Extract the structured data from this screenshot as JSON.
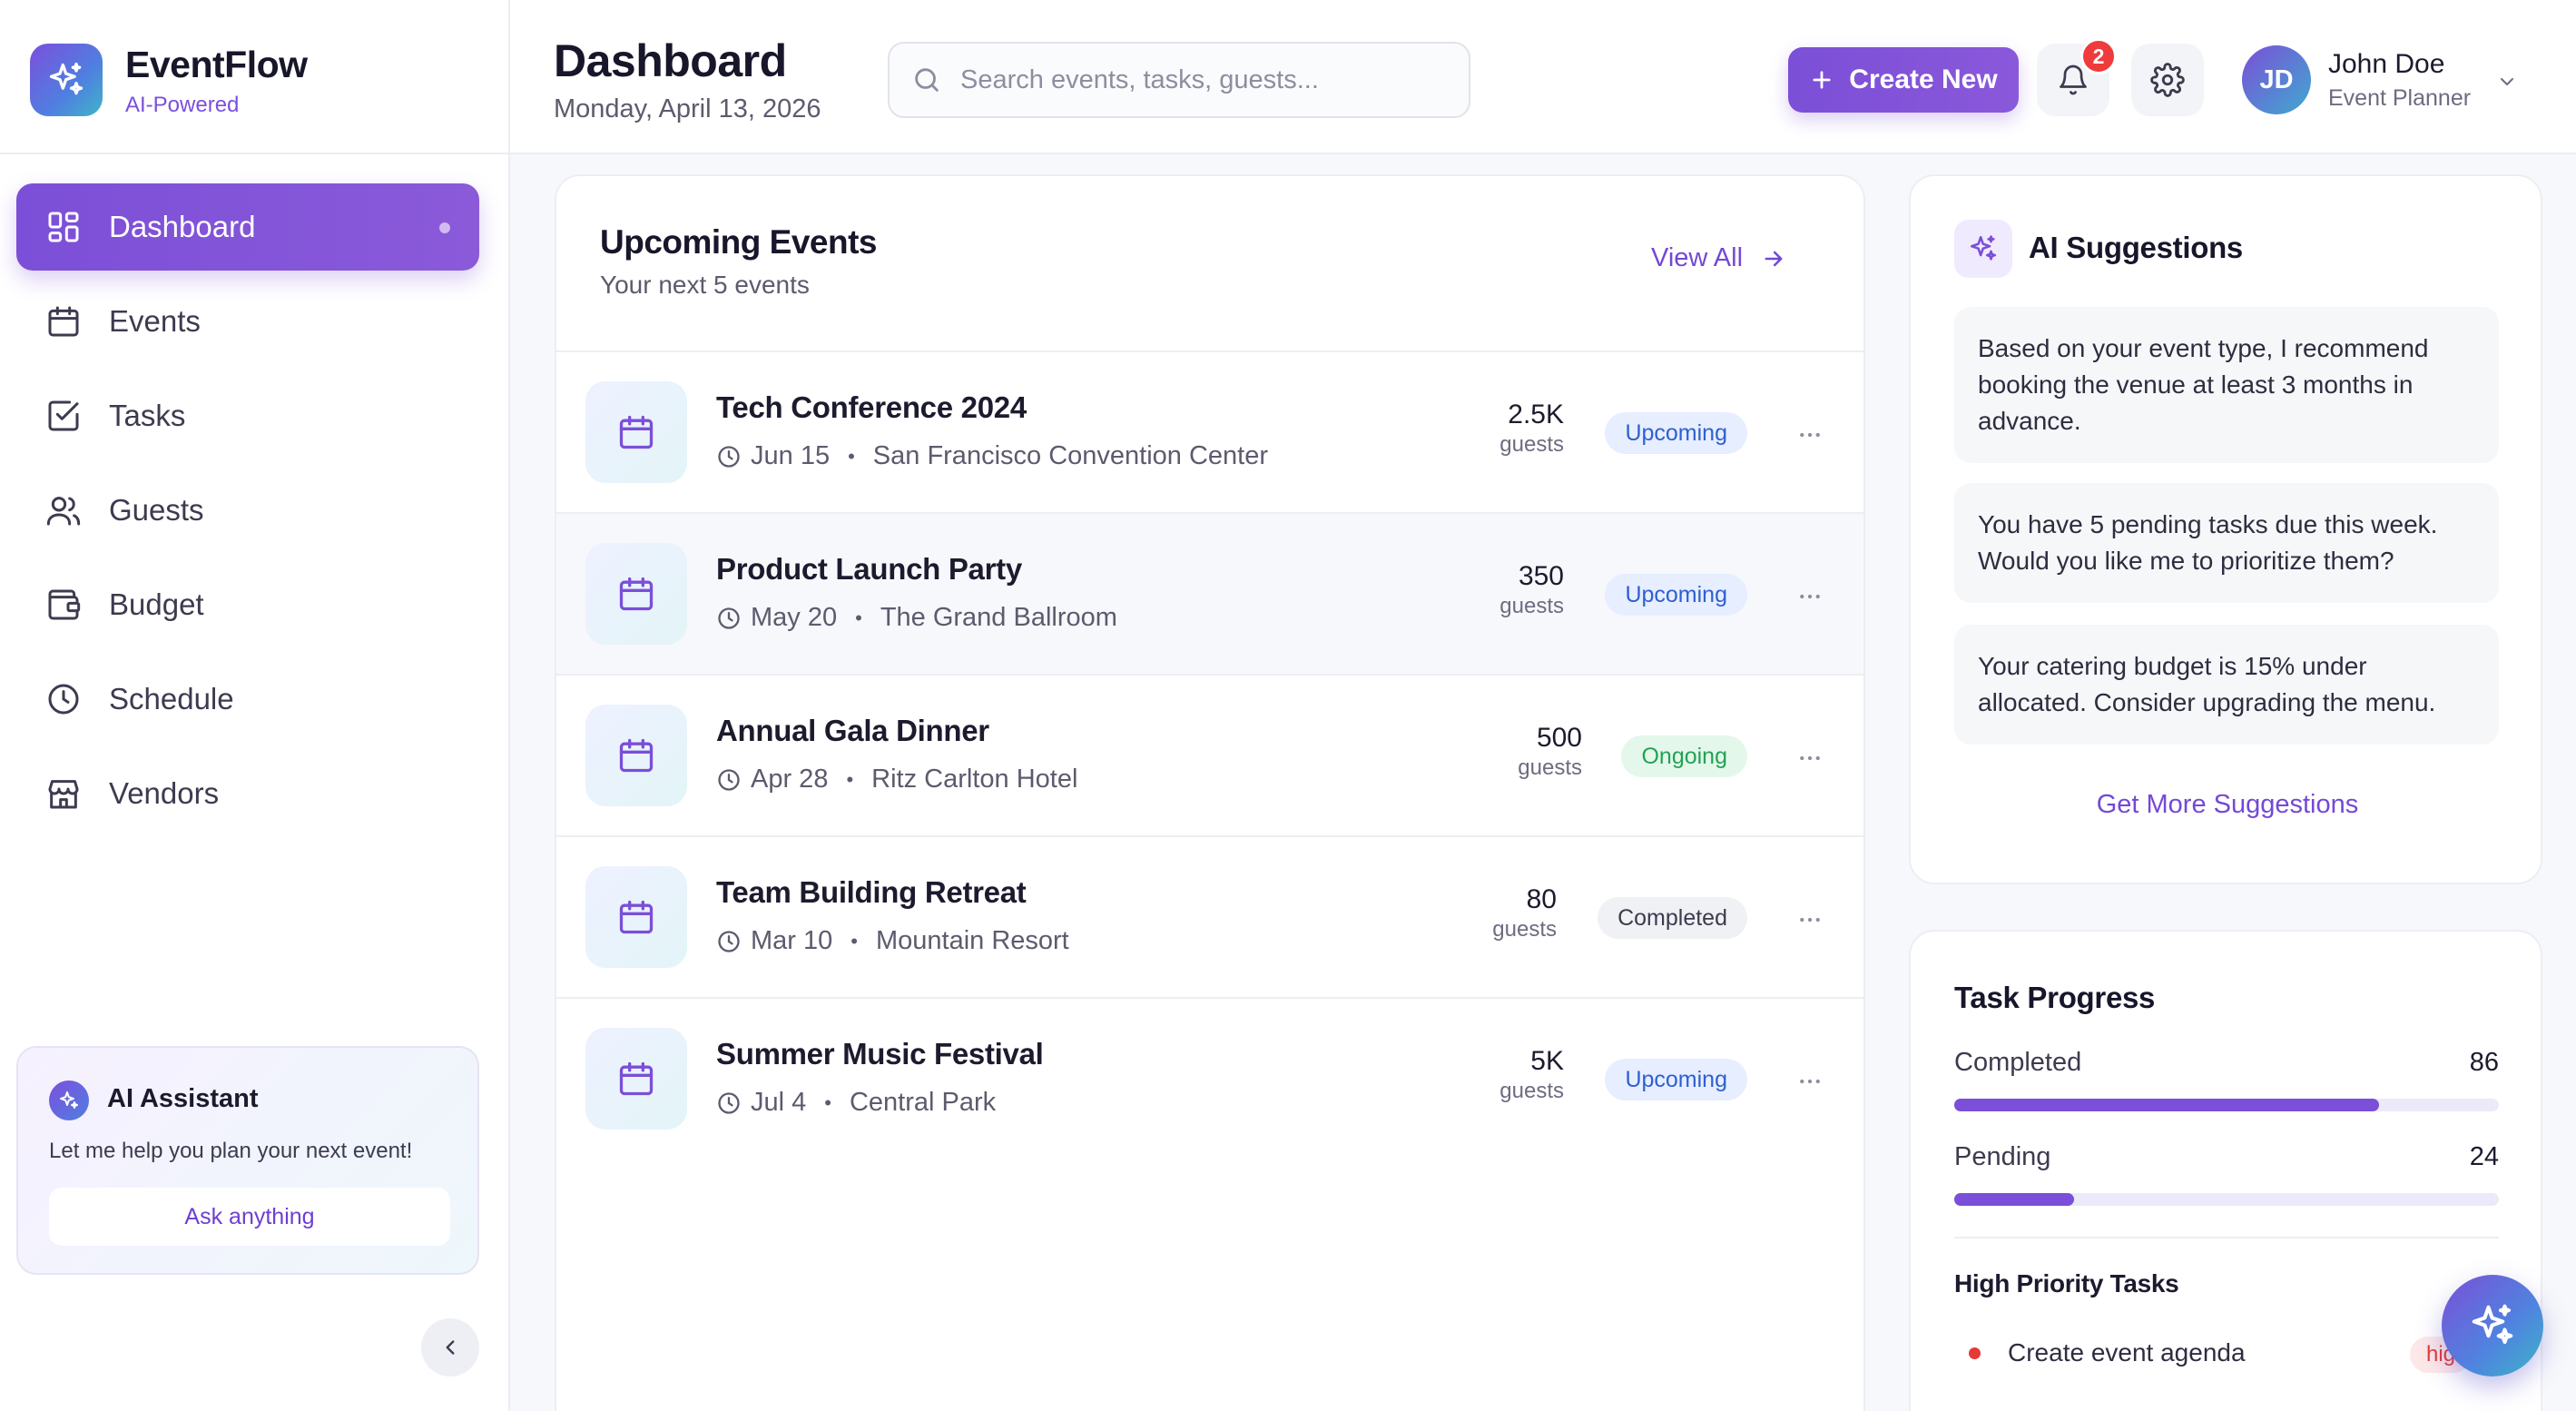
{
  "brand": {
    "name": "EventFlow",
    "tagline": "AI-Powered"
  },
  "sidebar": {
    "items": [
      {
        "label": "Dashboard",
        "icon": "dashboard-grid-icon",
        "active": true
      },
      {
        "label": "Events",
        "icon": "calendar-icon",
        "active": false
      },
      {
        "label": "Tasks",
        "icon": "checkbox-icon",
        "active": false
      },
      {
        "label": "Guests",
        "icon": "users-icon",
        "active": false
      },
      {
        "label": "Budget",
        "icon": "wallet-icon",
        "active": false
      },
      {
        "label": "Schedule",
        "icon": "clock-icon",
        "active": false
      },
      {
        "label": "Vendors",
        "icon": "store-icon",
        "active": false
      }
    ],
    "assistant": {
      "title": "AI Assistant",
      "text": "Let me help you plan your next event!",
      "button": "Ask anything"
    }
  },
  "header": {
    "title": "Dashboard",
    "date": "Monday, April 13, 2026",
    "search_placeholder": "Search events, tasks, guests...",
    "create_label": "Create New",
    "notification_count": "2",
    "user": {
      "initials": "JD",
      "name": "John Doe",
      "role": "Event Planner"
    }
  },
  "events": {
    "title": "Upcoming Events",
    "subtitle": "Your next 5 events",
    "view_all": "View All",
    "items": [
      {
        "name": "Tech Conference 2024",
        "date": "Jun 15",
        "location": "San Francisco Convention Center",
        "guests": "2.5K",
        "guests_label": "guests",
        "status": "Upcoming"
      },
      {
        "name": "Product Launch Party",
        "date": "May 20",
        "location": "The Grand Ballroom",
        "guests": "350",
        "guests_label": "guests",
        "status": "Upcoming"
      },
      {
        "name": "Annual Gala Dinner",
        "date": "Apr 28",
        "location": "Ritz Carlton Hotel",
        "guests": "500",
        "guests_label": "guests",
        "status": "Ongoing"
      },
      {
        "name": "Team Building Retreat",
        "date": "Mar 10",
        "location": "Mountain Resort",
        "guests": "80",
        "guests_label": "guests",
        "status": "Completed"
      },
      {
        "name": "Summer Music Festival",
        "date": "Jul 4",
        "location": "Central Park",
        "guests": "5K",
        "guests_label": "guests",
        "status": "Upcoming"
      }
    ]
  },
  "suggestions": {
    "title": "AI Suggestions",
    "items": [
      "Based on your event type, I recommend booking the venue at least 3 months in advance.",
      "You have 5 pending tasks due this week. Would you like me to prioritize them?",
      "Your catering budget is 15% under allocated. Consider upgrading the menu."
    ],
    "more": "Get More Suggestions"
  },
  "tasks": {
    "title": "Task Progress",
    "completed_label": "Completed",
    "completed_value": "86",
    "completed_fraction": 0.78,
    "pending_label": "Pending",
    "pending_value": "24",
    "pending_fraction": 0.22,
    "high_priority_title": "High Priority Tasks",
    "high_priority": [
      {
        "label": "Create event agenda",
        "badge": "hig"
      }
    ]
  },
  "colors": {
    "accent": "#7b4fd7",
    "upcoming": "#2f5fd0",
    "ongoing": "#22a255",
    "danger": "#e53935"
  }
}
